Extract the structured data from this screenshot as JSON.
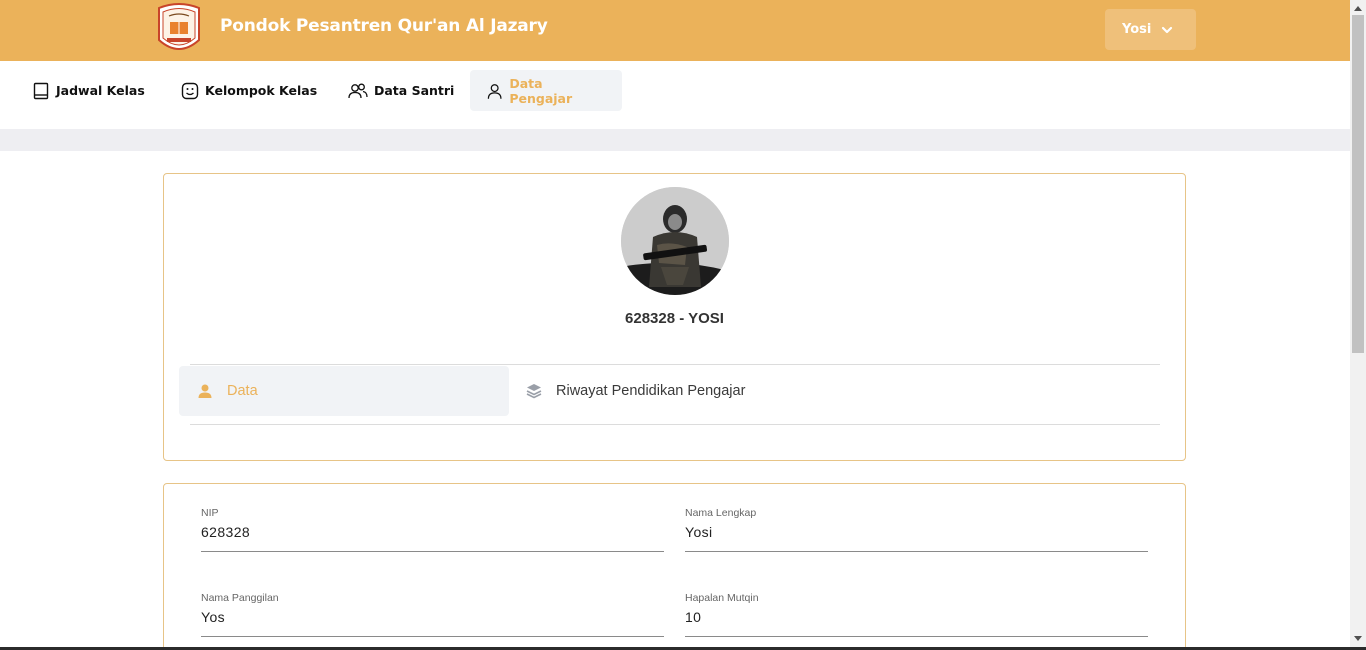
{
  "header": {
    "app_title": "Pondok Pesantren Qur'an Al Jazary",
    "user_name": "Yosi",
    "colors": {
      "brand": "#ebb25a",
      "header_text": "#ffffff"
    }
  },
  "nav": {
    "items": [
      {
        "label": "Jadwal Kelas",
        "icon": "book-icon"
      },
      {
        "label": "Kelompok Kelas",
        "icon": "smile-icon"
      },
      {
        "label": "Data Santri",
        "icon": "users-icon"
      },
      {
        "label": "Data Pengajar",
        "icon": "user-icon",
        "active": true
      }
    ]
  },
  "profile": {
    "title": "628328 - YOSI",
    "avatar": "avatar-photo",
    "tabs": [
      {
        "label": "Data",
        "icon": "person-icon",
        "active": true
      },
      {
        "label": "Riwayat Pendidikan Pengajar",
        "icon": "stack-icon"
      }
    ]
  },
  "form": {
    "fields": [
      {
        "label": "NIP",
        "value": "628328"
      },
      {
        "label": "Nama Lengkap",
        "value": "Yosi"
      },
      {
        "label": "Nama Panggilan",
        "value": "Yos"
      },
      {
        "label": "Hapalan Mutqin",
        "value": "10"
      }
    ]
  }
}
